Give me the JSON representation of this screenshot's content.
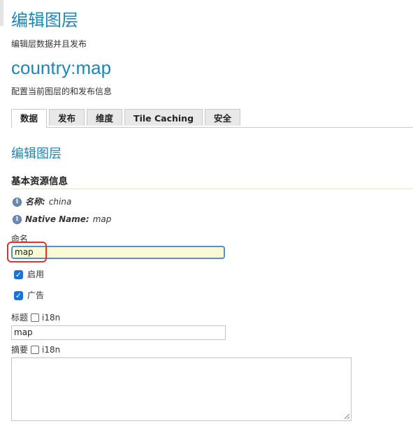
{
  "page": {
    "title": "编辑图层",
    "subtitle": "编辑层数据并且发布",
    "layer_name": "country:map",
    "layer_subtitle": "配置当前图层的和发布信息"
  },
  "tabs": [
    {
      "label": "数据",
      "active": true
    },
    {
      "label": "发布",
      "active": false
    },
    {
      "label": "维度",
      "active": false
    },
    {
      "label": "Tile Caching",
      "active": false
    },
    {
      "label": "安全",
      "active": false
    }
  ],
  "section": {
    "title": "编辑图层",
    "resource_heading": "基本资源信息"
  },
  "info": {
    "name_label": "名称:",
    "name_value": "china",
    "native_label": "Native Name:",
    "native_value": "map"
  },
  "form": {
    "name_label": "命名",
    "name_value": "map",
    "enabled_label": "启用",
    "enabled_checked": true,
    "advertised_label": "广告",
    "advertised_checked": true,
    "title_label": "标题",
    "title_i18n_label": "i18n",
    "title_value": "map",
    "abstract_label": "摘要",
    "abstract_i18n_label": "i18n",
    "abstract_value": ""
  },
  "icons": {
    "info": "info-icon",
    "checkbox": "checkbox-icon"
  },
  "colors": {
    "accent": "#1e85b6",
    "highlight": "#e0342a",
    "checkbox": "#1a73d9",
    "focus_input_bg": "#fbf8d8"
  }
}
